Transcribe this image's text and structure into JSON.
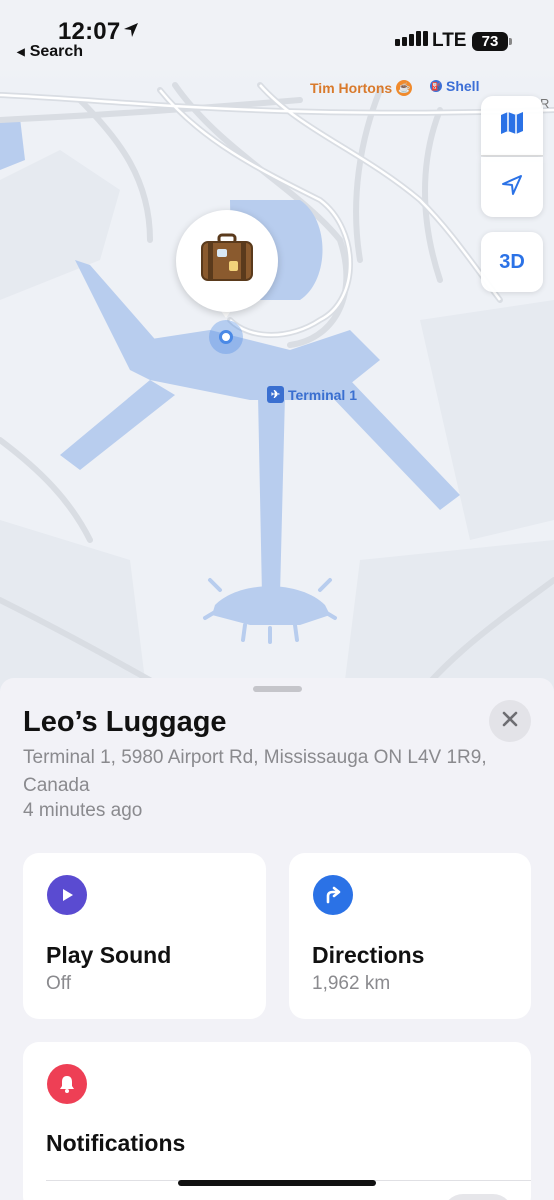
{
  "status_bar": {
    "time": "12:07",
    "back_label": "Search",
    "network": "LTE",
    "battery": "73"
  },
  "map": {
    "poi_tim_hortons": "Tim Hortons",
    "poi_shell": "Shell",
    "edge_label": "R",
    "terminal_label": "Terminal 1",
    "controls": {
      "map_mode_icon": "map-icon",
      "location_icon": "location-arrow-icon",
      "three_d_label": "3D"
    },
    "pin_emoji": "🧳",
    "colors": {
      "terminal": "#b8cdee",
      "water": "#b8cdee",
      "road": "#d9dde3",
      "accent": "#2b72e6"
    }
  },
  "item": {
    "name": "Leo’s Luggage",
    "address": "Terminal 1, 5980 Airport Rd, Mississauga ON L4V 1R9, Canada",
    "updated": "4 minutes ago"
  },
  "actions": {
    "play_sound": {
      "title": "Play Sound",
      "subtitle": "Off",
      "icon": "play-icon",
      "color": "#5a4bd1"
    },
    "directions": {
      "title": "Directions",
      "subtitle": "1,962 km",
      "icon": "turn-right-arrow-icon",
      "color": "#2b72e6"
    },
    "notifications": {
      "title": "Notifications",
      "icon": "bell-icon",
      "color": "#ee3f55"
    }
  }
}
